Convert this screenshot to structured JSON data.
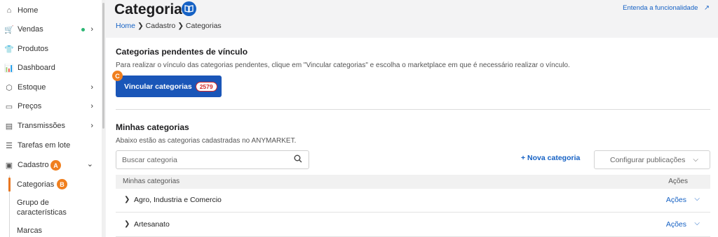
{
  "sidebar": {
    "items": [
      {
        "label": "Home",
        "icon": "home-icon",
        "glyph": "⌂"
      },
      {
        "label": "Vendas",
        "icon": "cart-icon",
        "glyph": "🛒"
      },
      {
        "label": "Produtos",
        "icon": "shirt-icon",
        "glyph": "👕"
      },
      {
        "label": "Dashboard",
        "icon": "bar-chart-icon",
        "glyph": "📊"
      },
      {
        "label": "Estoque",
        "icon": "box-icon",
        "glyph": "⬡"
      },
      {
        "label": "Preços",
        "icon": "tag-icon",
        "glyph": "▭"
      },
      {
        "label": "Transmissões",
        "icon": "monitor-icon",
        "glyph": "▤"
      },
      {
        "label": "Tarefas em lote",
        "icon": "list-icon",
        "glyph": "☰"
      },
      {
        "label": "Cadastro",
        "icon": "clipboard-icon",
        "glyph": "▣"
      }
    ],
    "chevron_right": "›",
    "chevron_down": "⌄",
    "sub_items": [
      "Categorias",
      "Grupo de\ncaracterísticas",
      "Marcas"
    ],
    "markers": {
      "a": "A",
      "b": "B",
      "c": "C"
    },
    "marker_color": "#f07f1e"
  },
  "header": {
    "title": "Categorias",
    "title_icon": "book-icon",
    "breadcrumb": [
      "Home",
      "Cadastro",
      "Categorias"
    ],
    "help_link": "Entenda a funcionalidade",
    "help_icon": "↗"
  },
  "pending": {
    "heading": "Categorias pendentes de vínculo",
    "description": "Para realizar o vínculo das categorias pendentes, clique em \"Vincular categorias\" e escolha o marketplace em que é necessário realizar o vínculo.",
    "button_label": "Vincular categorias",
    "count": "2579"
  },
  "mine": {
    "heading": "Minhas categorias",
    "description": "Abaixo estão as categorias cadastradas no ANYMARKET.",
    "search_placeholder": "Buscar categoria",
    "new_label": "+ Nova categoria",
    "config_label": "Configurar publicações",
    "table_headers": [
      "Minhas categorias",
      "Ações"
    ],
    "rows": [
      {
        "name": "Agro, Industria e Comercio",
        "action": "Ações"
      },
      {
        "name": "Artesanato",
        "action": "Ações"
      }
    ]
  },
  "colors": {
    "primary": "#1a56b8",
    "link": "#1561c4",
    "danger": "#d02828",
    "online": "#2bb673"
  }
}
